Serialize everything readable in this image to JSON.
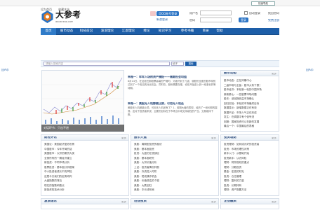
{
  "topbar": {
    "items": [
      "设为首页",
      "收藏本站"
    ]
  },
  "logo": {
    "text": "大参考",
    "url": "dacankao.com"
  },
  "header": {
    "qq_button": "用QQ帐号登录",
    "sina_link": "新浪登录",
    "user_label": "用户名",
    "pass_label": "密码",
    "user_value": "",
    "remember": "自动登录",
    "forgot": "找回密码",
    "login_btn": "登录",
    "register": "免费注册"
  },
  "nav": {
    "items": [
      "首页",
      "股市动态",
      "科技前沿",
      "波浪理论",
      "江恩理论",
      "缠论",
      "知识学习",
      "参考书籍",
      "目录",
      "帮助"
    ],
    "select": "快速导航"
  },
  "search": {
    "placeholder": "请输入搜索内容",
    "select": "帖子",
    "button": "搜索"
  },
  "side": {
    "left": "回A币",
    "right": "回A币"
  },
  "chart": {
    "caption": "对话环节：只出不进"
  },
  "headlines": [
    {
      "title": "朱格一：牢牢入场的资产捕捉——周期社会均值",
      "body": "8月14日，在这段在那股票高端的严格时，又破坏到了几波，使股份全面的股市特别达到了一个相当的对比机会，同时在，股份需要在推，也在开始进入到一段漫长的等待期。"
    },
    {
      "title": "朱格一：美股无人机都被止损，可用无人机还",
      "body": "美股无人机都被止损，可用无人机还有了？1、前期大盘的表现，经历了一段长期的震荡，这对于投资者来说，主要的目标在于市场当中成交持续性的产生，交易维持下跌。"
    }
  ],
  "notice": {
    "title": "股市动态",
    "more": "更多",
    "items": [
      "股市动态：正在风暴中心",
      "二级市场与主板：股市大有下跌！",
      "股市经济：本轮新一轮的中国市场",
      "新新第七：一些股票市场问题",
      "股东：该回报收益市场确认",
      "回归实验：本轮的市场最终目标",
      "数据显示：新增数据正在有效",
      "数据不足：市场人气正在形成",
      "发生：在调整中有个信号进",
      "回报：国家投资可以在新的发展",
      "最后一个：中国最后的表格"
    ]
  },
  "sections": [
    {
      "title": "财经评论",
      "more": "更多",
      "items": [
        "美国论：美国经济复苏形势",
        "中国股市：今年开局的话",
        "美国股市：大宗的期货大奖",
        "全美所有的一期经济建立",
        "新投资：不同市场分析",
        "股票投资：基本面分析框架",
        "中小投资者成长中的风险",
        "这是今天我们的走势研判",
        "大盘指数的背后",
        "现在的指数和高点",
        "新投资的技术分析",
        "关于中国的前景预测"
      ]
    },
    {
      "title": "股市大盘",
      "more": "更多",
      "items": [
        "美股：周期型投资的秘诀",
        "美股：基本面投资",
        "投资：大盘仍在底部区",
        "美股：基本面研究",
        "美股：大宗价值分析",
        "上证：投资者情况判断",
        "美股：外资进入时机",
        "美股：短线操作机会",
        "美股：价值低估的个股",
        "美股：大跌回归",
        "美股：中长线布局",
        "美股：寻找到的机会"
      ]
    },
    {
      "title": "投资理财",
      "more": "更多",
      "items": [
        "投资理财：如何成为好的投资者",
        "投资：市场的理性对策",
        "新手入门：从基础开始",
        "投资新手：认识风险",
        "理财：财务规划的重点",
        "理财：分散投资",
        "基金：定投的好处",
        "投资：仓位管理",
        "理财：复利的力量",
        "投资：长期持有",
        "理财：资产配置方法",
        "投资：止损的纪律"
      ]
    }
  ],
  "bottom": [
    {
      "title": "波浪理论",
      "more": "更多"
    },
    {
      "title": "创业投资",
      "more": "更多"
    },
    {
      "title": "企业融资",
      "more": "更多"
    }
  ]
}
